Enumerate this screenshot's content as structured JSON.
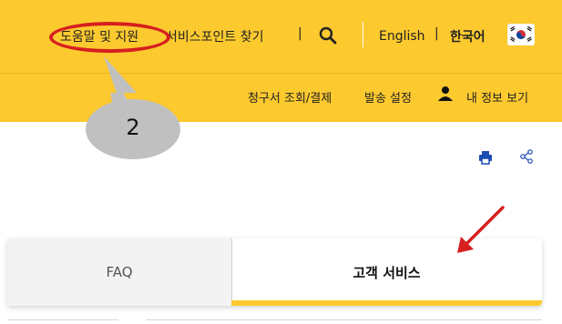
{
  "topbar": {
    "help_link": "도움말 및 지원",
    "service_points_link": "서비스포인트 찾기",
    "separator": "|",
    "lang_english": "English",
    "lang_separator": "|",
    "lang_korean": "한국어",
    "search_icon": "search-icon",
    "flag_icon": "korea-flag-icon"
  },
  "subbar": {
    "invoice_link": "청구서 조회/결제",
    "shipping_settings_link": "발송 설정",
    "my_info_link": "내 정보 보기",
    "user_icon": "user-icon"
  },
  "tools": {
    "print_icon": "printer-icon",
    "share_icon": "share-icon"
  },
  "annotation": {
    "step_number": "2",
    "circle_color": "#d61f1f",
    "arrow_color": "#d61f1f",
    "bubble_color": "#c0c0c0"
  },
  "tabs": [
    {
      "label": "FAQ",
      "active": false
    },
    {
      "label": "고객 서비스",
      "active": true
    }
  ],
  "colors": {
    "brand_yellow": "#fcc92f",
    "tab_underline": "#fcc92f"
  }
}
